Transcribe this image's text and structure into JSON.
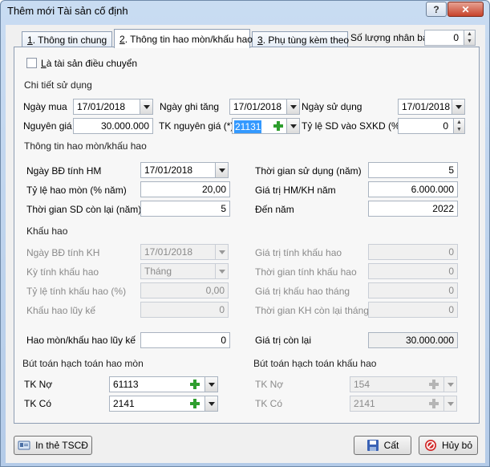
{
  "window": {
    "title": "Thêm mới Tài sản cố định",
    "help_label": "?",
    "min_label": "–",
    "close_label": "✕"
  },
  "tabs": [
    {
      "key": "1",
      "label": ". Thông tin chung"
    },
    {
      "key": "2",
      "label": ". Thông tin hao mòn/khấu hao"
    },
    {
      "key": "3",
      "label": ". Phụ tùng kèm theo"
    }
  ],
  "so_luong": {
    "label": "Số lượng nhân bản",
    "value": "0"
  },
  "dieu_chuyen": {
    "label_u": "L",
    "label_rest": "à tài sản điều chuyển"
  },
  "chi_tiet": {
    "title": "Chi tiết sử dụng",
    "ngay_mua": {
      "label": "Ngày mua",
      "value": "17/01/2018"
    },
    "ngay_ghi_tang": {
      "label": "Ngày ghi tăng",
      "value": "17/01/2018"
    },
    "ngay_su_dung": {
      "label": "Ngày sử dụng",
      "value": "17/01/2018"
    },
    "nguyen_gia": {
      "label": "Nguyên giá",
      "value": "30.000.000"
    },
    "tk_nguyen_gia": {
      "label": "TK nguyên giá (*)",
      "value": "21131"
    },
    "ty_le_sd": {
      "label": "Tỷ lệ SD vào SXKD (%)",
      "value": "0"
    }
  },
  "hao_mon": {
    "title": "Thông tin hao mòn/khấu hao",
    "ngay_bd": {
      "label": "Ngày BĐ tính HM",
      "value": "17/01/2018"
    },
    "thoi_gian_sd": {
      "label": "Thời gian sử dụng (năm)",
      "value": "5"
    },
    "ty_le_hm": {
      "label": "Tỷ lệ hao mòn (% năm)",
      "value": "20,00"
    },
    "gia_tri_hm": {
      "label": "Giá trị HM/KH năm",
      "value": "6.000.000"
    },
    "thoi_gian_con_lai": {
      "label": "Thời gian SD còn lại (năm)",
      "value": "5"
    },
    "den_nam": {
      "label": "Đến năm",
      "value": "2022"
    }
  },
  "khau_hao": {
    "title": "Khấu hao",
    "ngay_bd_kh": {
      "label": "Ngày BĐ tính KH",
      "value": "17/01/2018"
    },
    "gia_tri_tinh_kh": {
      "label": "Giá trị tính khấu hao",
      "value": "0"
    },
    "ky_tinh_kh": {
      "label": "Kỳ tính khấu hao",
      "value": "Tháng"
    },
    "thoi_gian_tinh_kh": {
      "label": "Thời gian tính khấu hao",
      "value": "0"
    },
    "ty_le_tinh_kh": {
      "label": "Tỷ lệ tính khấu hao (%)",
      "value": "0,00"
    },
    "gia_tri_kh_thang": {
      "label": "Giá trị khấu hao tháng",
      "value": "0"
    },
    "kh_luy_ke": {
      "label": "Khấu hao lũy kế",
      "value": "0"
    },
    "thoi_gian_kh_con_lai": {
      "label": "Thời gian KH còn lại tháng",
      "value": "0"
    }
  },
  "hm_luy_ke": {
    "label": "Hao mòn/khấu hao lũy kế",
    "value": "0"
  },
  "gia_tri_con_lai": {
    "label": "Giá trị còn lại",
    "value": "30.000.000"
  },
  "but_toan_hm": {
    "title": "Bút toán hạch toán hao mòn",
    "tk_no": {
      "label": "TK Nợ",
      "value": "61113"
    },
    "tk_co": {
      "label": "TK Có",
      "value": "2141"
    }
  },
  "but_toan_kh": {
    "title": "Bút toán hạch toán khấu hao",
    "tk_no": {
      "label": "TK Nợ",
      "value": "154"
    },
    "tk_co": {
      "label": "TK Có",
      "value": "2141"
    }
  },
  "buttons": {
    "print": "In thẻ TSCĐ",
    "save": "Cất",
    "cancel": "Hủy bỏ"
  },
  "colors": {
    "selection": "#3399ff",
    "plus_green": "#2e9e2e",
    "cancel_red": "#d12a2a"
  }
}
